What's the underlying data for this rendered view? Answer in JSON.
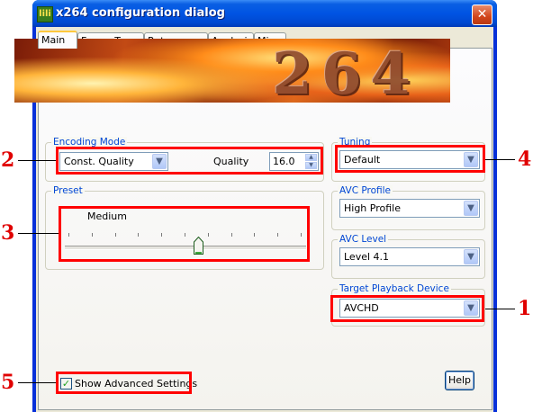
{
  "window": {
    "title": "x264 configuration dialog",
    "app_icon": "x264-icon",
    "close_glyph": "✕"
  },
  "tabs": [
    {
      "label": "Main",
      "active": true
    },
    {
      "label": "Frame-Type",
      "active": false
    },
    {
      "label": "Rate Control",
      "active": false
    },
    {
      "label": "Analysis",
      "active": false
    },
    {
      "label": "Misc",
      "active": false
    }
  ],
  "banner": {
    "text": "264"
  },
  "encoding_mode": {
    "group_label": "Encoding Mode",
    "mode": "Const. Quality",
    "quality_label": "Quality",
    "quality_value": "16.0"
  },
  "preset": {
    "group_label": "Preset",
    "value": "Medium",
    "slider_position": 0.56
  },
  "tuning": {
    "group_label": "Tuning",
    "value": "Default"
  },
  "avc_profile": {
    "group_label": "AVC Profile",
    "value": "High Profile"
  },
  "avc_level": {
    "group_label": "AVC Level",
    "value": "Level 4.1"
  },
  "playback_device": {
    "group_label": "Target Playback Device",
    "value": "AVCHD"
  },
  "advanced": {
    "label": "Show Advanced Settings",
    "checked": true
  },
  "help_label": "Help",
  "callout_numbers": {
    "n1": "1",
    "n2": "2",
    "n3": "3",
    "n4": "4",
    "n5": "5"
  },
  "colors": {
    "callout": "#ff0000",
    "titlebar": "#0054e3",
    "group_label": "#0046d5"
  }
}
